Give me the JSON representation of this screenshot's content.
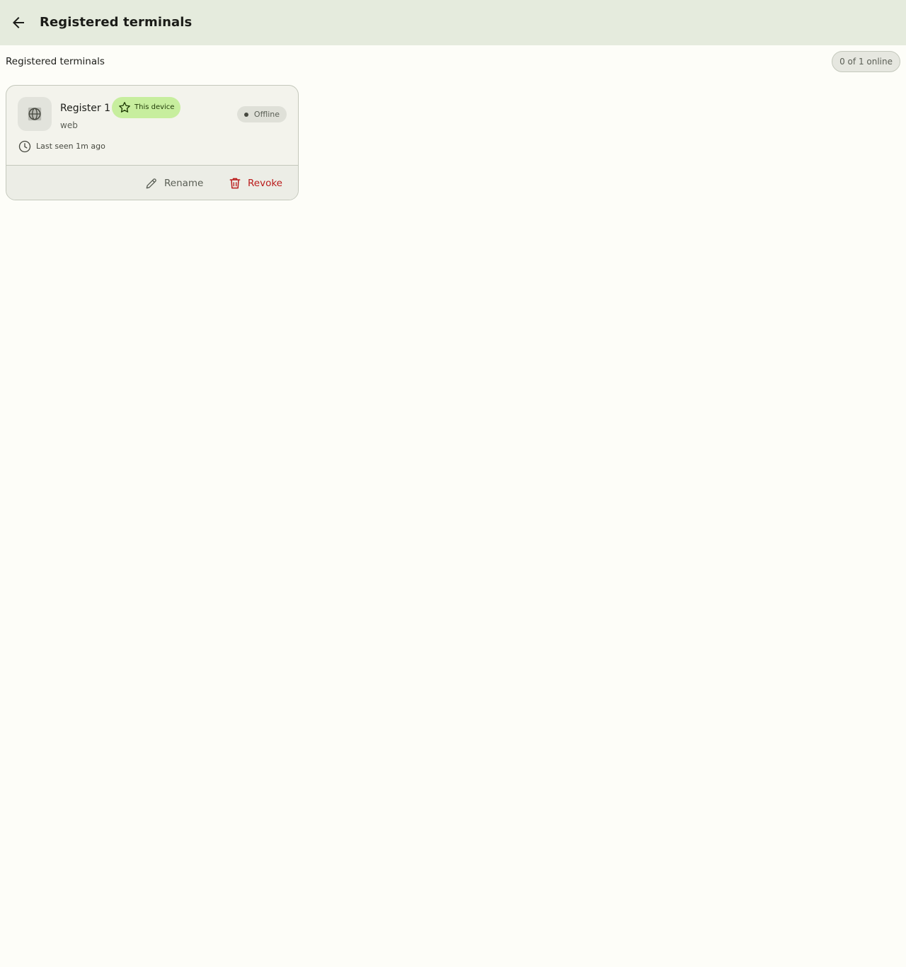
{
  "app_bar": {
    "title": "Registered terminals",
    "back_icon": "arrow-left-icon"
  },
  "section": {
    "title": "Registered terminals",
    "online_summary": "0 of 1 online"
  },
  "terminals": [
    {
      "name": "Register 1",
      "badge": "This device",
      "badge_icon": "star-outline-icon",
      "type": "web",
      "type_icon": "globe-icon",
      "status": "Offline",
      "last_seen": "Last seen 1m ago",
      "last_seen_icon": "clock-icon",
      "actions": {
        "rename_label": "Rename",
        "rename_icon": "pencil-icon",
        "revoke_label": "Revoke",
        "revoke_icon": "trash-icon"
      }
    }
  ],
  "colors": {
    "app_bar_bg": "#e5ebdd",
    "page_bg": "#fdfdf8",
    "badge_bg": "#c7ee9e",
    "danger": "#ba1a1a"
  }
}
